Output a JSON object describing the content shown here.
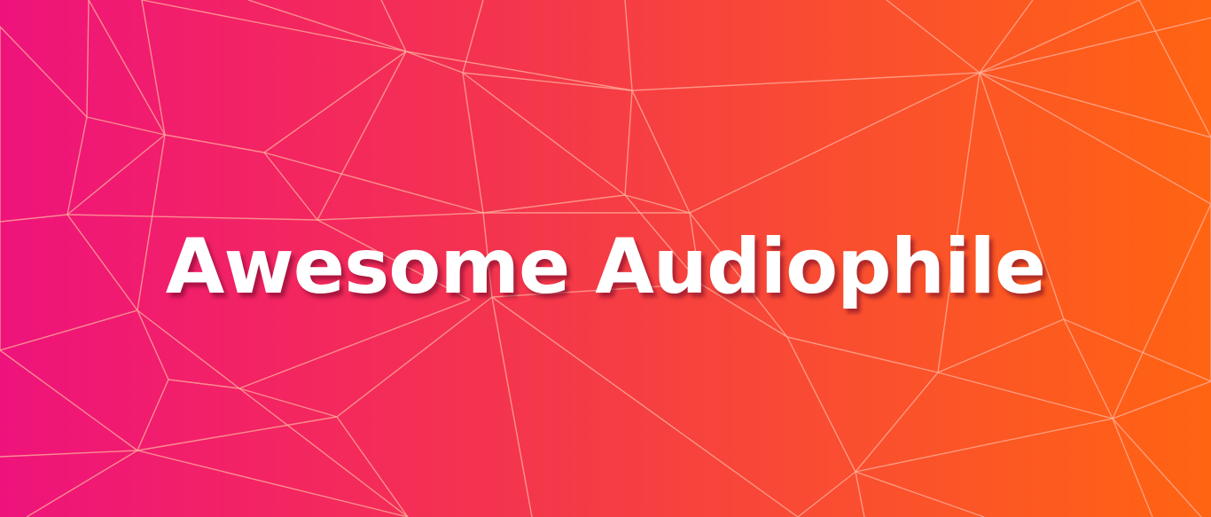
{
  "banner": {
    "title": "Awesome Audiophile",
    "gradient_start": "#ee137c",
    "gradient_end": "#ff6412",
    "mesh_line_color": "#ffb29e",
    "title_color": "#ffffff"
  }
}
